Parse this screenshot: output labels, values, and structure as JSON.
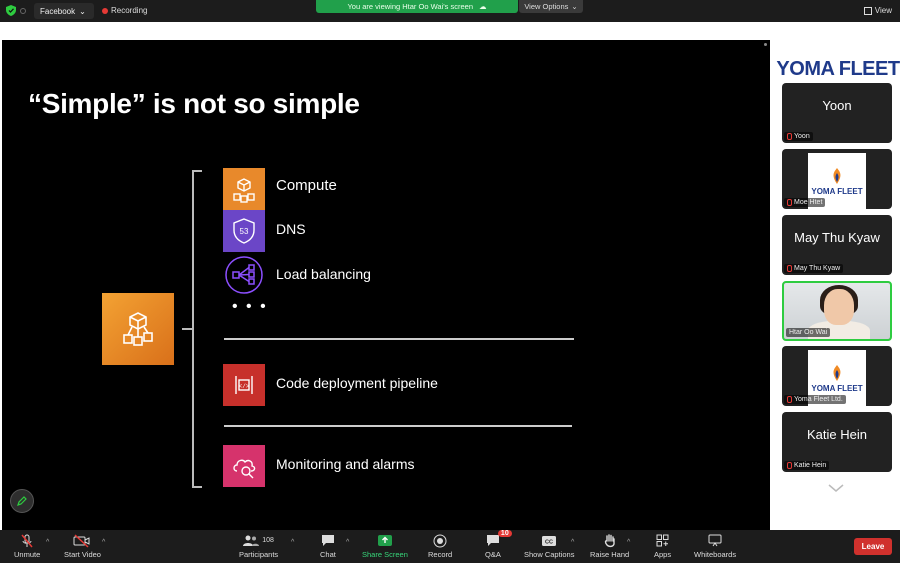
{
  "topbar": {
    "source_label": "Facebook",
    "recording_label": "Recording",
    "viewing_notice": "You are viewing Htar Oo Wai's screen",
    "view_options_label": "View Options",
    "view_label": "View"
  },
  "slide": {
    "title": "“Simple” is not so simple",
    "items": [
      {
        "label": "Compute",
        "icon": "compute-icon",
        "color": "#e8892b"
      },
      {
        "label": "DNS",
        "icon": "route53-icon",
        "color": "#6b46c7"
      },
      {
        "label": "Load balancing",
        "icon": "load-balancer-icon",
        "color": "#8c4fff"
      },
      {
        "label": "Code deployment pipeline",
        "icon": "pipeline-icon",
        "color": "#c7302b"
      },
      {
        "label": "Monitoring and alarms",
        "icon": "monitoring-icon",
        "color": "#d6336c"
      }
    ],
    "ellipsis": "• • •"
  },
  "panel": {
    "brand": "YOMA FLEET",
    "participants": [
      {
        "name": "Yoon",
        "tag": "Yoon",
        "kind": "name"
      },
      {
        "name": "",
        "tag": "Moe Htet",
        "kind": "logo",
        "logo_text": "YOMA FLEET"
      },
      {
        "name": "May Thu Kyaw",
        "tag": "May Thu Kyaw",
        "kind": "name"
      },
      {
        "name": "",
        "tag": "Htar Oo Wai",
        "kind": "video"
      },
      {
        "name": "",
        "tag": "Yoma Fleet Ltd.",
        "kind": "logo",
        "logo_text": "YOMA FLEET"
      },
      {
        "name": "Katie Hein",
        "tag": "Katie Hein",
        "kind": "name"
      }
    ]
  },
  "toolbar": {
    "unmute": "Unmute",
    "start_video": "Start Video",
    "participants": "Participants",
    "participants_count": "108",
    "chat": "Chat",
    "share_screen": "Share Screen",
    "record": "Record",
    "qa": "Q&A",
    "qa_badge": "10",
    "show_captions": "Show Captions",
    "raise_hand": "Raise Hand",
    "apps": "Apps",
    "whiteboards": "Whiteboards",
    "leave": "Leave"
  },
  "colors": {
    "share_green": "#21a04b",
    "leave_red": "#d0312d",
    "brand_blue": "#1f3a8a"
  }
}
